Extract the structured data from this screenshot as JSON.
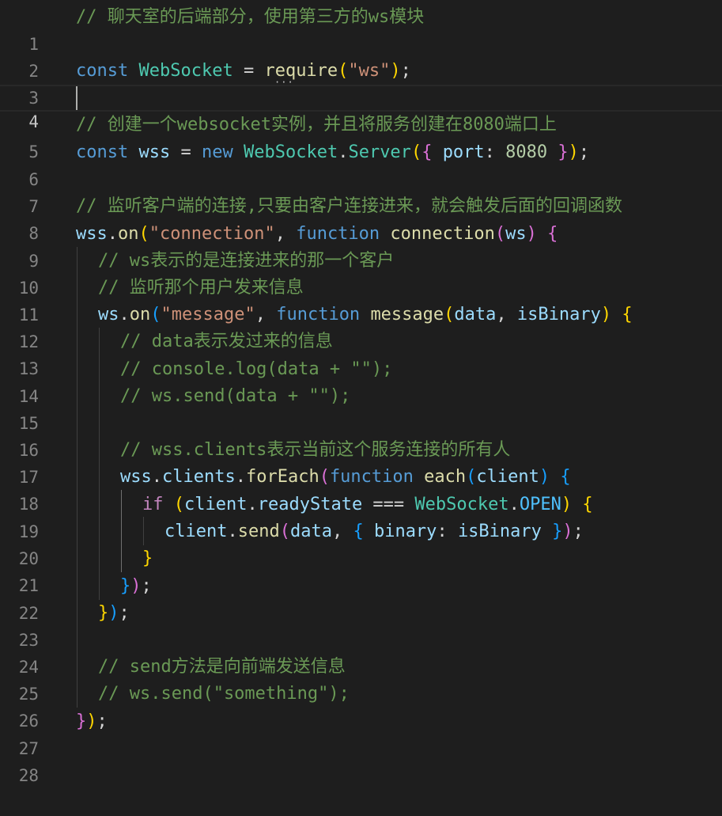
{
  "editor": {
    "current_line": 4,
    "line_numbers": [
      "1",
      "2",
      "3",
      "4",
      "5",
      "6",
      "7",
      "8",
      "9",
      "10",
      "11",
      "12",
      "13",
      "14",
      "15",
      "16",
      "17",
      "18",
      "19",
      "20",
      "21",
      "22",
      "23",
      "24",
      "25",
      "26",
      "27",
      "28"
    ],
    "code": {
      "l1": [
        "// 聊天室的后端部分，使用第三方的ws模块"
      ],
      "l3": [
        "const",
        " ",
        "WebSocket",
        " = ",
        "require",
        "(",
        "\"ws\"",
        ")",
        ";"
      ],
      "l5": [
        "// 创建一个websocket实例，并且将服务创建在8080端口上"
      ],
      "l6": [
        "const",
        " ",
        "wss",
        " = ",
        "new",
        " ",
        "WebSocket",
        ".",
        "Server",
        "(",
        "{",
        " ",
        "port",
        ": ",
        "8080",
        " ",
        "}",
        ")",
        ";"
      ],
      "l8": [
        "// 监听客户端的连接,只要由客户连接进来，就会触发后面的回调函数"
      ],
      "l9": [
        "wss",
        ".",
        "on",
        "(",
        "\"connection\"",
        ", ",
        "function",
        " ",
        "connection",
        "(",
        "ws",
        ")",
        " ",
        "{"
      ],
      "l10": [
        "// ws表示的是连接进来的那一个客户"
      ],
      "l11": [
        "// 监听那个用户发来信息"
      ],
      "l12": [
        "ws",
        ".",
        "on",
        "(",
        "\"message\"",
        ", ",
        "function",
        " ",
        "message",
        "(",
        "data",
        ", ",
        "isBinary",
        ")",
        " ",
        "{"
      ],
      "l13": [
        "// data表示发过来的信息"
      ],
      "l14": [
        "// console.log(data + \"\");"
      ],
      "l15": [
        "// ws.send(data + \"\");"
      ],
      "l17": [
        "// wss.clients表示当前这个服务连接的所有人"
      ],
      "l18": [
        "wss",
        ".",
        "clients",
        ".",
        "forEach",
        "(",
        "function",
        " ",
        "each",
        "(",
        "client",
        ")",
        " ",
        "{"
      ],
      "l19": [
        "if",
        " ",
        "(",
        "client",
        ".",
        "readyState",
        " === ",
        "WebSocket",
        ".",
        "OPEN",
        ")",
        " ",
        "{"
      ],
      "l20": [
        "client",
        ".",
        "send",
        "(",
        "data",
        ", ",
        "{",
        " ",
        "binary",
        ": ",
        "isBinary",
        " ",
        "}",
        ")",
        ";"
      ],
      "l21": [
        "}"
      ],
      "l22": [
        "}",
        ")",
        ";"
      ],
      "l23": [
        "}",
        ")",
        ";"
      ],
      "l25": [
        "// send方法是向前端发送信息"
      ],
      "l26": [
        "// ws.send(\"something\");"
      ],
      "l27": [
        "}",
        ")",
        ";"
      ]
    }
  },
  "theme": {
    "background": "#1e1e1e",
    "line_number": "#858585",
    "keyword": "#569cd6",
    "control_keyword": "#c586c0",
    "variable": "#9cdcfe",
    "class": "#4ec9b0",
    "function": "#dcdcaa",
    "string": "#ce9178",
    "number": "#b5cea8",
    "comment": "#6a9955",
    "bracket_level1": "#ffd700",
    "bracket_level2": "#da70d6",
    "bracket_level3": "#179fff"
  }
}
